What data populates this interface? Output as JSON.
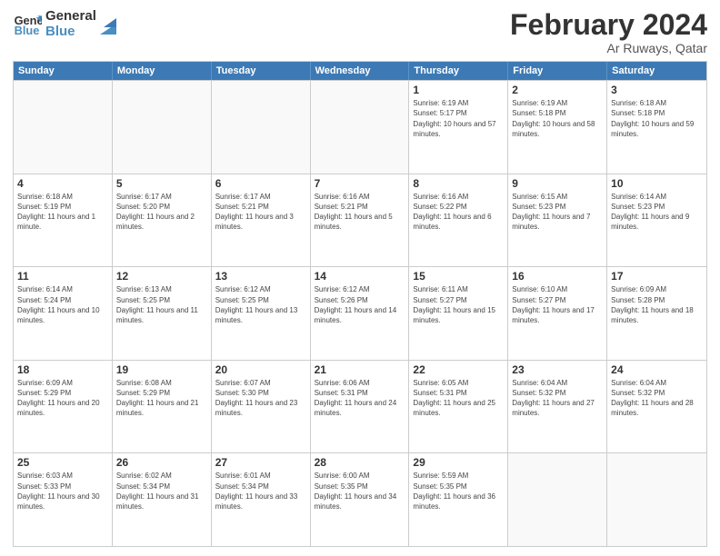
{
  "logo": {
    "line1": "General",
    "line2": "Blue"
  },
  "title": "February 2024",
  "subtitle": "Ar Ruways, Qatar",
  "days_of_week": [
    "Sunday",
    "Monday",
    "Tuesday",
    "Wednesday",
    "Thursday",
    "Friday",
    "Saturday"
  ],
  "weeks": [
    [
      {
        "day": "",
        "empty": true
      },
      {
        "day": "",
        "empty": true
      },
      {
        "day": "",
        "empty": true
      },
      {
        "day": "",
        "empty": true
      },
      {
        "day": "1",
        "sunrise": "6:19 AM",
        "sunset": "5:17 PM",
        "daylight": "10 hours and 57 minutes."
      },
      {
        "day": "2",
        "sunrise": "6:19 AM",
        "sunset": "5:18 PM",
        "daylight": "10 hours and 58 minutes."
      },
      {
        "day": "3",
        "sunrise": "6:18 AM",
        "sunset": "5:18 PM",
        "daylight": "10 hours and 59 minutes."
      }
    ],
    [
      {
        "day": "4",
        "sunrise": "6:18 AM",
        "sunset": "5:19 PM",
        "daylight": "11 hours and 1 minute."
      },
      {
        "day": "5",
        "sunrise": "6:17 AM",
        "sunset": "5:20 PM",
        "daylight": "11 hours and 2 minutes."
      },
      {
        "day": "6",
        "sunrise": "6:17 AM",
        "sunset": "5:21 PM",
        "daylight": "11 hours and 3 minutes."
      },
      {
        "day": "7",
        "sunrise": "6:16 AM",
        "sunset": "5:21 PM",
        "daylight": "11 hours and 5 minutes."
      },
      {
        "day": "8",
        "sunrise": "6:16 AM",
        "sunset": "5:22 PM",
        "daylight": "11 hours and 6 minutes."
      },
      {
        "day": "9",
        "sunrise": "6:15 AM",
        "sunset": "5:23 PM",
        "daylight": "11 hours and 7 minutes."
      },
      {
        "day": "10",
        "sunrise": "6:14 AM",
        "sunset": "5:23 PM",
        "daylight": "11 hours and 9 minutes."
      }
    ],
    [
      {
        "day": "11",
        "sunrise": "6:14 AM",
        "sunset": "5:24 PM",
        "daylight": "11 hours and 10 minutes."
      },
      {
        "day": "12",
        "sunrise": "6:13 AM",
        "sunset": "5:25 PM",
        "daylight": "11 hours and 11 minutes."
      },
      {
        "day": "13",
        "sunrise": "6:12 AM",
        "sunset": "5:25 PM",
        "daylight": "11 hours and 13 minutes."
      },
      {
        "day": "14",
        "sunrise": "6:12 AM",
        "sunset": "5:26 PM",
        "daylight": "11 hours and 14 minutes."
      },
      {
        "day": "15",
        "sunrise": "6:11 AM",
        "sunset": "5:27 PM",
        "daylight": "11 hours and 15 minutes."
      },
      {
        "day": "16",
        "sunrise": "6:10 AM",
        "sunset": "5:27 PM",
        "daylight": "11 hours and 17 minutes."
      },
      {
        "day": "17",
        "sunrise": "6:09 AM",
        "sunset": "5:28 PM",
        "daylight": "11 hours and 18 minutes."
      }
    ],
    [
      {
        "day": "18",
        "sunrise": "6:09 AM",
        "sunset": "5:29 PM",
        "daylight": "11 hours and 20 minutes."
      },
      {
        "day": "19",
        "sunrise": "6:08 AM",
        "sunset": "5:29 PM",
        "daylight": "11 hours and 21 minutes."
      },
      {
        "day": "20",
        "sunrise": "6:07 AM",
        "sunset": "5:30 PM",
        "daylight": "11 hours and 23 minutes."
      },
      {
        "day": "21",
        "sunrise": "6:06 AM",
        "sunset": "5:31 PM",
        "daylight": "11 hours and 24 minutes."
      },
      {
        "day": "22",
        "sunrise": "6:05 AM",
        "sunset": "5:31 PM",
        "daylight": "11 hours and 25 minutes."
      },
      {
        "day": "23",
        "sunrise": "6:04 AM",
        "sunset": "5:32 PM",
        "daylight": "11 hours and 27 minutes."
      },
      {
        "day": "24",
        "sunrise": "6:04 AM",
        "sunset": "5:32 PM",
        "daylight": "11 hours and 28 minutes."
      }
    ],
    [
      {
        "day": "25",
        "sunrise": "6:03 AM",
        "sunset": "5:33 PM",
        "daylight": "11 hours and 30 minutes."
      },
      {
        "day": "26",
        "sunrise": "6:02 AM",
        "sunset": "5:34 PM",
        "daylight": "11 hours and 31 minutes."
      },
      {
        "day": "27",
        "sunrise": "6:01 AM",
        "sunset": "5:34 PM",
        "daylight": "11 hours and 33 minutes."
      },
      {
        "day": "28",
        "sunrise": "6:00 AM",
        "sunset": "5:35 PM",
        "daylight": "11 hours and 34 minutes."
      },
      {
        "day": "29",
        "sunrise": "5:59 AM",
        "sunset": "5:35 PM",
        "daylight": "11 hours and 36 minutes."
      },
      {
        "day": "",
        "empty": true
      },
      {
        "day": "",
        "empty": true
      }
    ]
  ]
}
